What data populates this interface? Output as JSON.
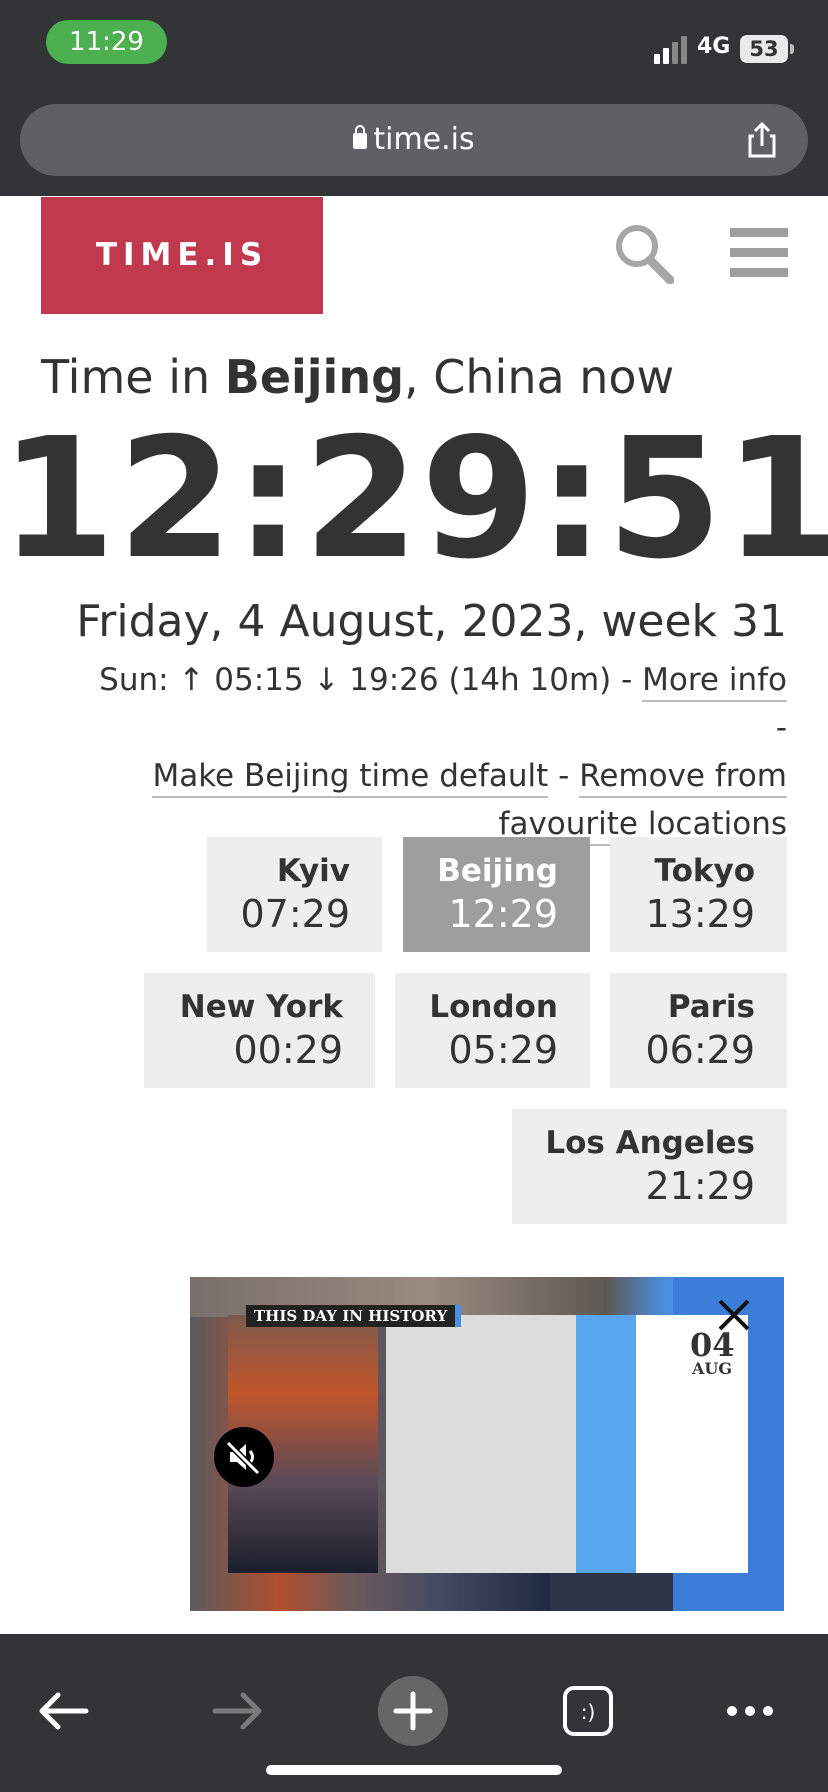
{
  "status_bar": {
    "time": "11:29",
    "network": "4G",
    "battery": "53"
  },
  "browser": {
    "url": "time.is"
  },
  "site": {
    "logo": "TIME.IS"
  },
  "headline": {
    "prefix": "Time in ",
    "city": "Beijing",
    "suffix": ", China now"
  },
  "clock": "12:29:51",
  "date_line": "Friday, 4 August, 2023, week 31",
  "sun_info": {
    "text": "Sun: ↑ 05:15 ↓ 19:26 (14h 10m) - ",
    "more_info": "More info",
    "sep1": " -",
    "make_default": "Make Beijing time default",
    "sep2": " - ",
    "remove_favourite": "Remove from favourite locations"
  },
  "cities": [
    {
      "name": "Kyiv",
      "time": "07:29"
    },
    {
      "name": "Beijing",
      "time": "12:29"
    },
    {
      "name": "Tokyo",
      "time": "13:29"
    },
    {
      "name": "New York",
      "time": "00:29"
    },
    {
      "name": "London",
      "time": "05:29"
    },
    {
      "name": "Paris",
      "time": "06:29"
    },
    {
      "name": "Los Angeles",
      "time": "21:29"
    }
  ],
  "ad": {
    "label": "THIS DAY IN HISTORY",
    "day": "04",
    "month": "AUG"
  },
  "colors": {
    "brand": "#c0394f",
    "chrome": "#333435",
    "active_tile": "#9e9e9e",
    "tile": "#eeeeee"
  },
  "icons": [
    "lock-icon",
    "share-icon",
    "search-icon",
    "menu-icon",
    "close-icon",
    "mute-icon",
    "back-icon",
    "forward-icon",
    "new-tab-icon",
    "tabs-icon",
    "more-icon"
  ]
}
